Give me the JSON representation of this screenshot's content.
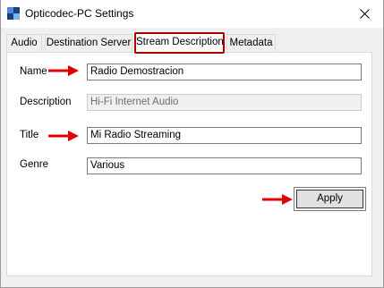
{
  "window": {
    "title": "Opticodec-PC Settings",
    "icons": {
      "app": "app-icon",
      "close": "close-icon"
    }
  },
  "tabs": [
    {
      "label": "Audio",
      "active": false
    },
    {
      "label": "Destination Server",
      "active": false
    },
    {
      "label": "Stream Description",
      "active": true
    },
    {
      "label": "Metadata",
      "active": false
    }
  ],
  "form": {
    "name": {
      "label": "Name",
      "value": "Radio Demostracion"
    },
    "description": {
      "label": "Description",
      "value": "Hi-Fi Internet Audio",
      "disabled": true
    },
    "title": {
      "label": "Title",
      "value": "Mi Radio Streaming"
    },
    "genre": {
      "label": "Genre",
      "value": "Various"
    }
  },
  "apply_label": "Apply",
  "colors": {
    "annotation_arrow": "#e00000",
    "tab_highlight": "#b00000"
  }
}
